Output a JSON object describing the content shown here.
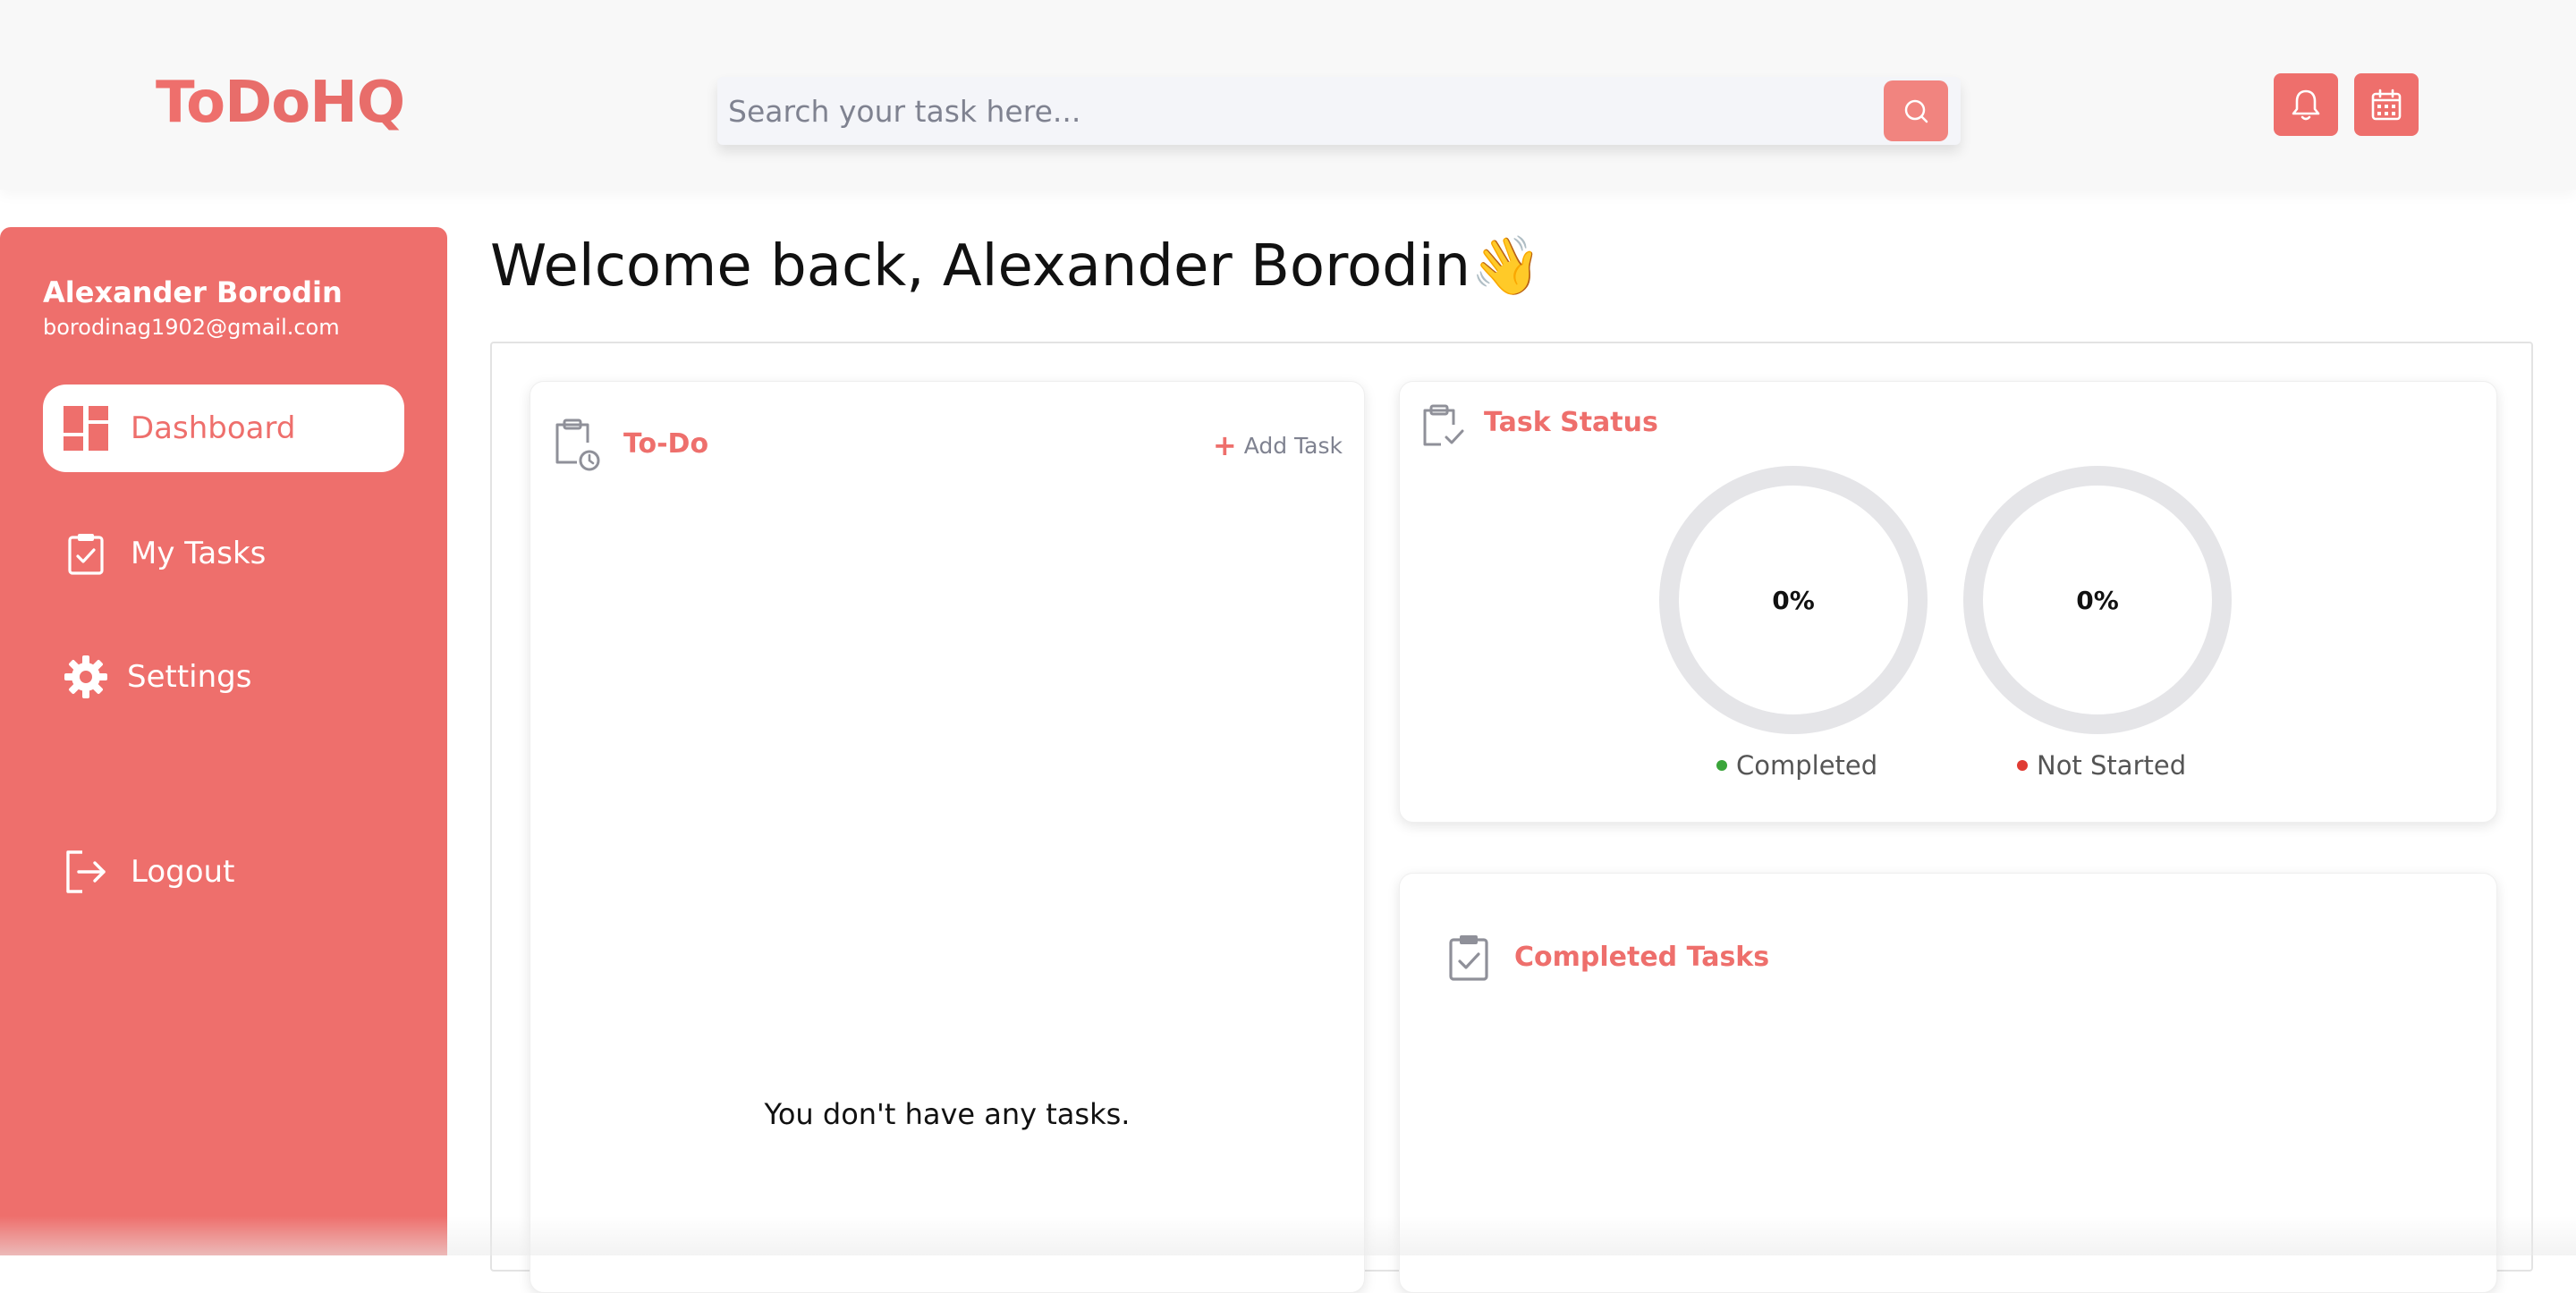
{
  "app": {
    "logo_part1": "To",
    "logo_part2": "DoHQ",
    "accent_color": "#ee6f6c"
  },
  "search": {
    "placeholder": "Search your task here...",
    "icon": "search-icon"
  },
  "header": {
    "notification_icon": "bell-icon",
    "calendar_icon": "calendar-icon"
  },
  "sidebar": {
    "user_name": "Alexander Borodin",
    "user_email": "borodinag1902@gmail.com",
    "items": [
      {
        "label": "Dashboard",
        "icon": "dashboard-icon",
        "active": true
      },
      {
        "label": "My Tasks",
        "icon": "clipboard-check-icon",
        "active": false
      },
      {
        "label": "Settings",
        "icon": "gear-icon",
        "active": false
      },
      {
        "label": "Logout",
        "icon": "logout-icon",
        "active": false
      }
    ]
  },
  "main": {
    "welcome": "Welcome back, Alexander Borodin",
    "welcome_emoji": "👋",
    "todo": {
      "title": "To-Do",
      "add_label": "Add Task",
      "empty_message": "You don't have any tasks."
    },
    "task_status": {
      "title": "Task Status",
      "rings": [
        {
          "value": "0%",
          "label": "Completed",
          "dot_color": "#3aa53a",
          "percent": 0
        },
        {
          "value": "0%",
          "label": "Not Started",
          "dot_color": "#e03b33",
          "percent": 0
        }
      ]
    },
    "completed": {
      "title": "Completed Tasks"
    }
  }
}
